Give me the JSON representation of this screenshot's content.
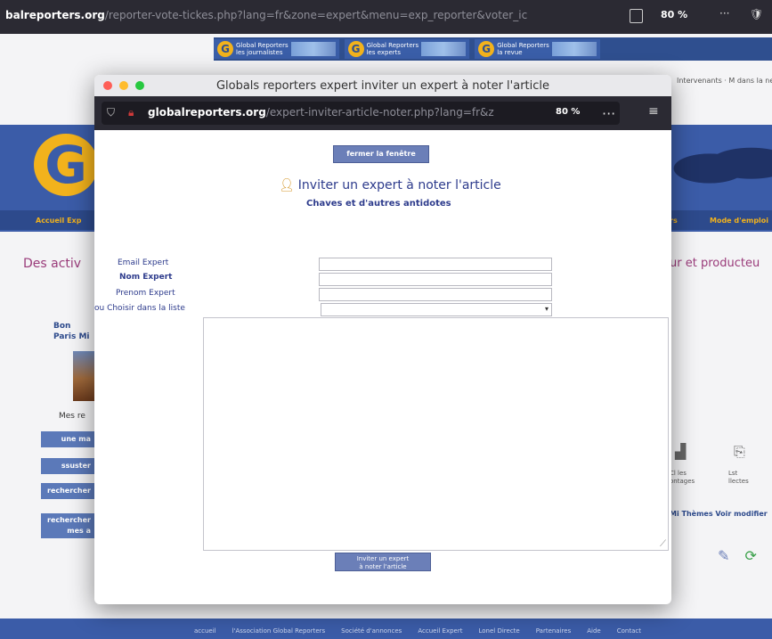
{
  "browser": {
    "url_domain": "balreporters.org",
    "url_path": "/reporter-vote-tickes.php?lang=fr&zone=expert&menu=exp_reporter&voter_ic",
    "zoom": "80 %"
  },
  "site": {
    "ad_units": [
      {
        "logo": "G",
        "text": "Global Reporters\nles journalistes"
      },
      {
        "logo": "G",
        "text": "Global Reporters\nles experts"
      },
      {
        "logo": "G",
        "text": "Global Reporters\nla revue"
      }
    ],
    "top_right_text": "Intervenants · M dans la newsletter",
    "top_right_m": "M",
    "logo_letter": "G",
    "nav_left": "Accueil Exp",
    "nav_right_1": "rs",
    "nav_right_2": "Mode d'emploi",
    "title_left": "Des activ",
    "title_right": "ur et producteu",
    "left_text": "Bon\nParis Mi",
    "mes_label": "Mes re",
    "left_buttons": [
      "une ma",
      "ssuster",
      "rechercher",
      "rechercher\nmes a"
    ],
    "right_icons": [
      {
        "icon": "chart-icon",
        "label": "Cl les\nontages"
      },
      {
        "icon": "document-icon",
        "label": "Lst\nllectes"
      }
    ],
    "right_link": "Mi Thèmes Voir modifier",
    "footer_links": [
      "accueil",
      "l'Association Global Reporters",
      "Société d'annonces",
      "Accueil Expert",
      "Lonel Directe",
      "Partenaires",
      "Aide",
      "Contact"
    ]
  },
  "popup": {
    "window_title": "Globals reporters expert inviter un expert à noter l'article",
    "url_domain": "globalreporters.org",
    "url_path": "/expert-inviter-article-noter.php?lang=fr&z",
    "zoom": "80 %",
    "close_button": "fermer la fenêtre",
    "heading": "Inviter un expert à noter l'article",
    "subheading": "Chaves et d'autres antidotes",
    "fields": {
      "email_label": "Email Expert",
      "nom_label": "Nom Expert",
      "prenom_label": "Prenom Expert",
      "choose_label": "ou Choisir dans la liste",
      "email_value": "",
      "nom_value": "",
      "prenom_value": "",
      "select_value": "",
      "message_value": ""
    },
    "submit_button": "Inviter un expert\nà noter l'article"
  },
  "colors": {
    "brand_blue": "#3b5ca8",
    "brand_gold": "#f2b21c",
    "button_blue": "#6b7fb8",
    "title_purple": "#9a3b7a"
  }
}
